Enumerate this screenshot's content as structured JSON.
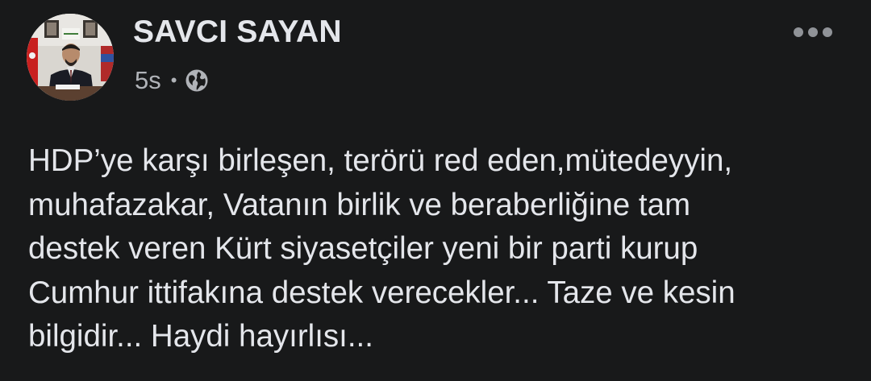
{
  "post": {
    "author": "SAVCI SAYAN",
    "timestamp": "5s",
    "separator": "•",
    "privacy_icon": "globe-icon",
    "more_icon": "more-options-icon",
    "body": "HDP’ye karşı birleşen, terörü red eden,mütedeyyin,\nmuhafazakar, Vatanın birlik ve beraberliğine tam\ndestek veren Kürt siyasetçiler yeni bir parti kurup\nCumhur ittifakına destek verecekler... Taze ve kesin\nbilgidir... Haydi hayırlısı..."
  },
  "colors": {
    "background": "#18191a",
    "primary_text": "#e4e6eb",
    "secondary_text": "#b0b3b8"
  }
}
